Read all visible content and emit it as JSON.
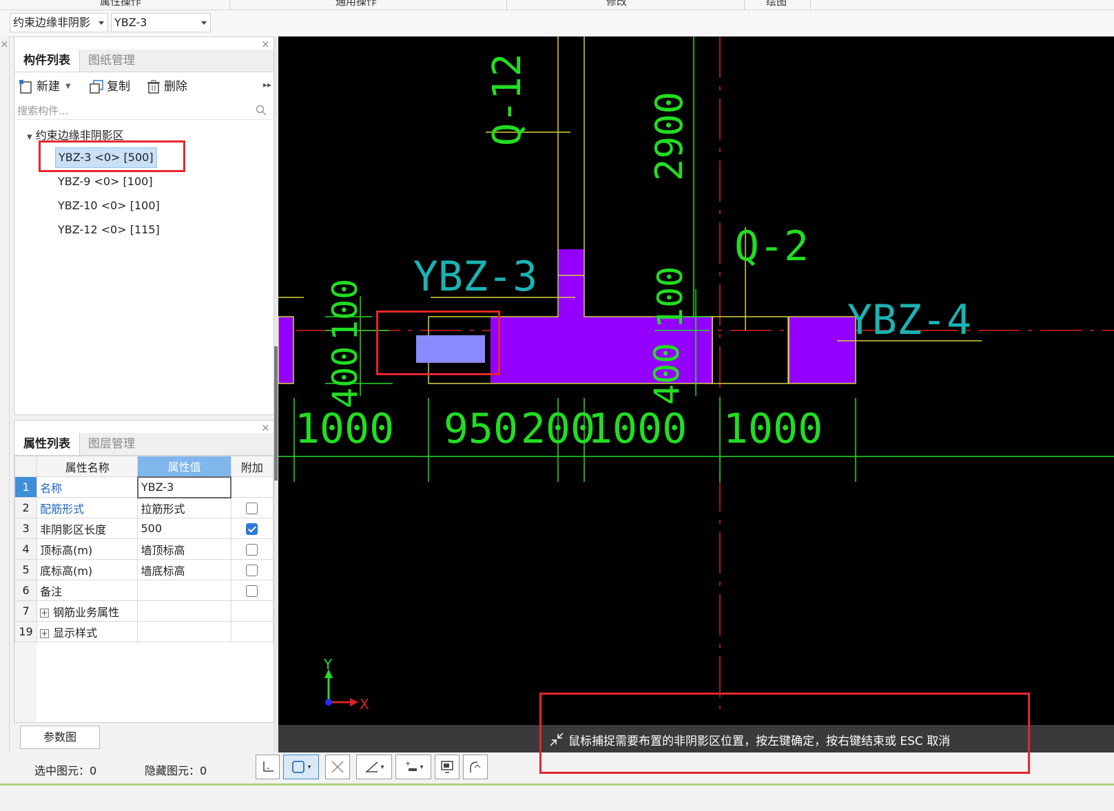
{
  "top_tabs": [
    "属性操作",
    "通用操作",
    "修改",
    "绘图"
  ],
  "dropdowns": {
    "type": "约束边缘非阴影",
    "component": "YBZ-3"
  },
  "component_panel": {
    "tabs": [
      "构件列表",
      "图纸管理"
    ],
    "toolbar": {
      "new": "新建",
      "copy": "复制",
      "delete": "删除"
    },
    "search_placeholder": "搜索构件...",
    "tree_root": "约束边缘非阴影区",
    "items": [
      "YBZ-3 <0> [500]",
      "YBZ-9 <0> [100]",
      "YBZ-10 <0> [100]",
      "YBZ-12 <0> [115]"
    ]
  },
  "property_panel": {
    "tabs": [
      "属性列表",
      "图层管理"
    ],
    "headers": [
      "属性名称",
      "属性值",
      "附加"
    ],
    "rows": [
      {
        "num": "1",
        "name": "名称",
        "value": "YBZ-3",
        "checkbox": "none"
      },
      {
        "num": "2",
        "name": "配筋形式",
        "value": "拉筋形式",
        "checkbox": "off"
      },
      {
        "num": "3",
        "name": "非阴影区长度",
        "value": "500",
        "checkbox": "on"
      },
      {
        "num": "4",
        "name": "顶标高(m)",
        "value": "墙顶标高",
        "checkbox": "off"
      },
      {
        "num": "5",
        "name": "底标高(m)",
        "value": "墙底标高",
        "checkbox": "off"
      },
      {
        "num": "6",
        "name": "备注",
        "value": "",
        "checkbox": "off"
      },
      {
        "num": "7",
        "name": "钢筋业务属性",
        "value": "",
        "checkbox": "none"
      },
      {
        "num": "19",
        "name": "显示样式",
        "value": "",
        "checkbox": "none"
      }
    ],
    "param_button": "参数图"
  },
  "status": {
    "selected": "选中图元：0",
    "hidden": "隐藏图元：0"
  },
  "drawing": {
    "labels": [
      "Q-12",
      "2900",
      "YBZ-3",
      "Q-2",
      "YBZ-4",
      "100",
      "100",
      "400",
      "100",
      "400"
    ],
    "dimensions": [
      "1000",
      "950",
      "200",
      "1000",
      "1000"
    ],
    "axis_x": "X",
    "axis_y": "Y"
  },
  "prompt": "鼠标捕捉需要布置的非阴影区位置，按左键确定，按右键结束或 ESC 取消",
  "colors": {
    "wall_fill": "#9300ff",
    "selected_fill": "#8a8aff",
    "dim_green": "#22dd22",
    "yellow": "#d8d23a",
    "axis_red": "#e02020",
    "label_cyan": "#1ab3b3"
  }
}
